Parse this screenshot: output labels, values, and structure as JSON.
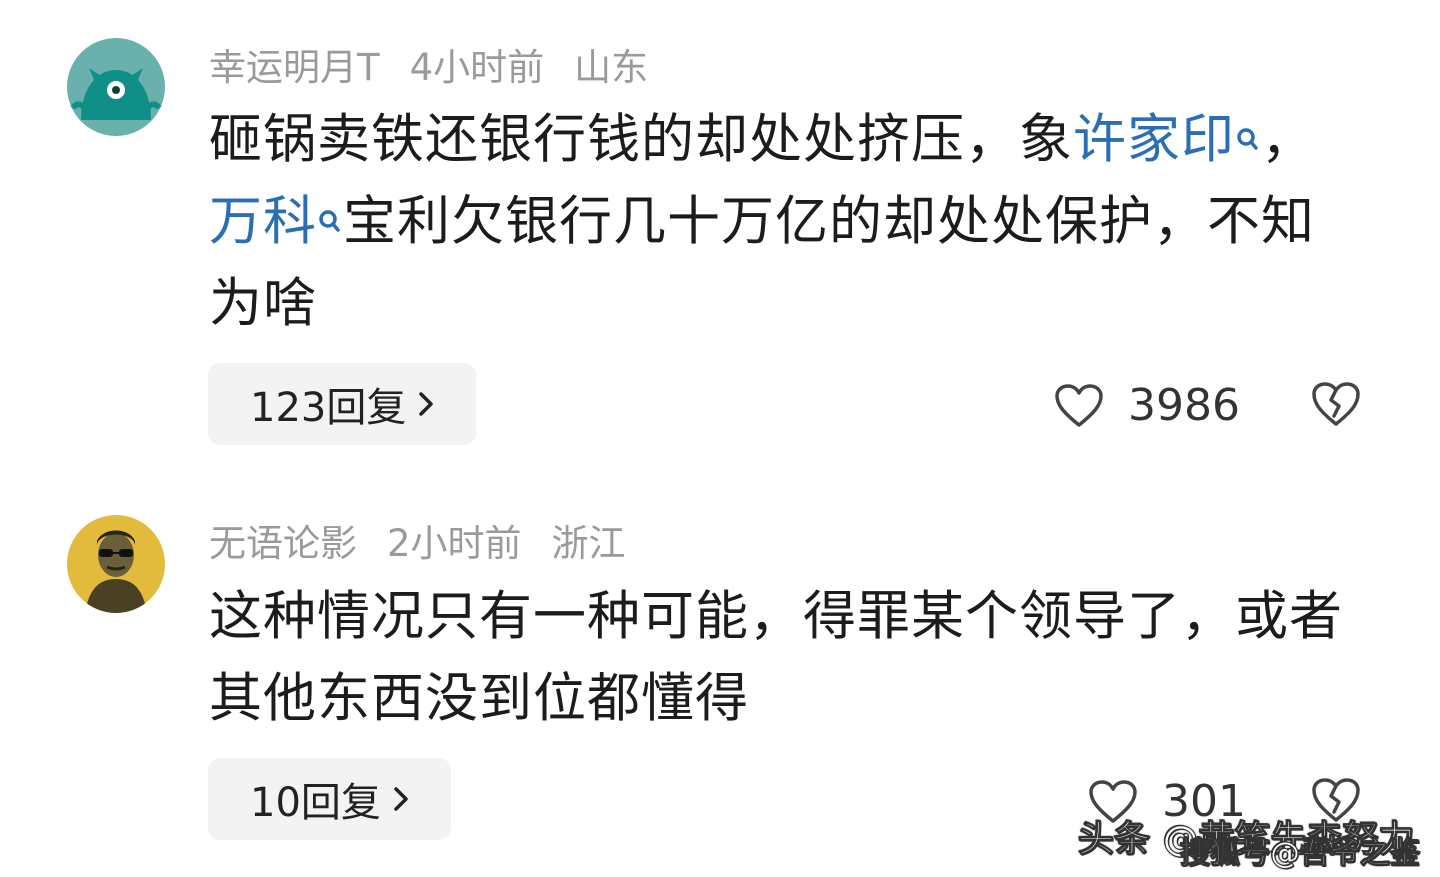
{
  "comments": [
    {
      "username": "幸运明月T",
      "time": "4小时前",
      "location": "山东",
      "text_part1": "砸锅卖铁还银行钱的却处处挤压，象",
      "link1": "许家印",
      "text_part2": "，",
      "link2": "万科",
      "text_part3": "宝利欠银行几十万亿的却处处保护，不知为啥",
      "reply_label": "123回复",
      "likes": "3986"
    },
    {
      "username": "无语论影",
      "time": "2小时前",
      "location": "浙江",
      "text": "这种情况只有一种可能，得罪某个领导了，或者其他东西没到位都懂得",
      "reply_label": "10回复",
      "likes": "301"
    }
  ],
  "watermark": {
    "line1": "头条 @黄笑先森努力",
    "line2": "搜狐号@吾爷之鉴"
  },
  "colors": {
    "link": "#2a6fb4",
    "meta": "#9a9a9a",
    "reply_bg": "#f3f3f3"
  },
  "icons": {
    "like": "heart-icon",
    "dislike": "broken-heart-icon",
    "search": "search-icon",
    "chevron": "chevron-right-icon"
  }
}
